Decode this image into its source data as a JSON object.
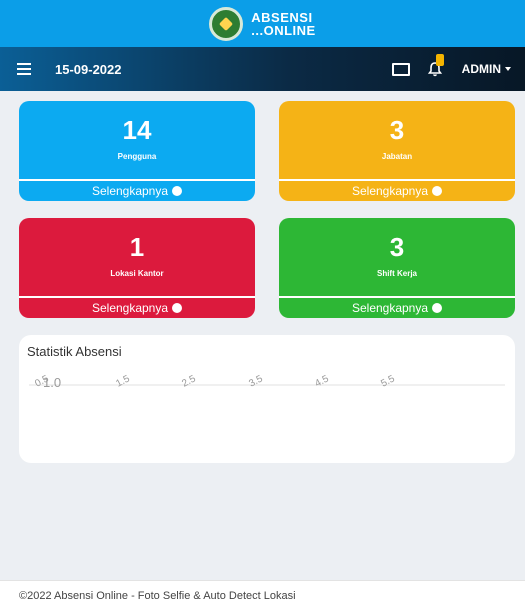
{
  "brand": {
    "line1": "ABSENSI",
    "line2": "...ONLINE"
  },
  "navbar": {
    "date": "15-09-2022",
    "user": "ADMIN"
  },
  "cards": [
    {
      "value": "14",
      "label": "Pengguna",
      "link": "Selengkapnya",
      "color": "#0caaf1"
    },
    {
      "value": "3",
      "label": "Jabatan",
      "link": "Selengkapnya",
      "color": "#f5b316"
    },
    {
      "value": "1",
      "label": "Lokasi Kantor",
      "link": "Selengkapnya",
      "color": "#dc1a3d"
    },
    {
      "value": "3",
      "label": "Shift Kerja",
      "link": "Selengkapnya",
      "color": "#2db735"
    }
  ],
  "statistics": {
    "title": "Statistik Absensi",
    "axis_labels": [
      "0.5",
      "1.0",
      "1.5",
      "2.5",
      "3.5",
      "4.5",
      "5.5"
    ]
  },
  "footer": {
    "text": "©2022 Absensi Online - Foto Selfie & Auto Detect Lokasi"
  },
  "icons": [
    "seal-logo-icon",
    "hamburger-menu-icon",
    "desktop-icon",
    "bell-icon",
    "caret-down-icon",
    "arrow-circle-right-icon"
  ]
}
